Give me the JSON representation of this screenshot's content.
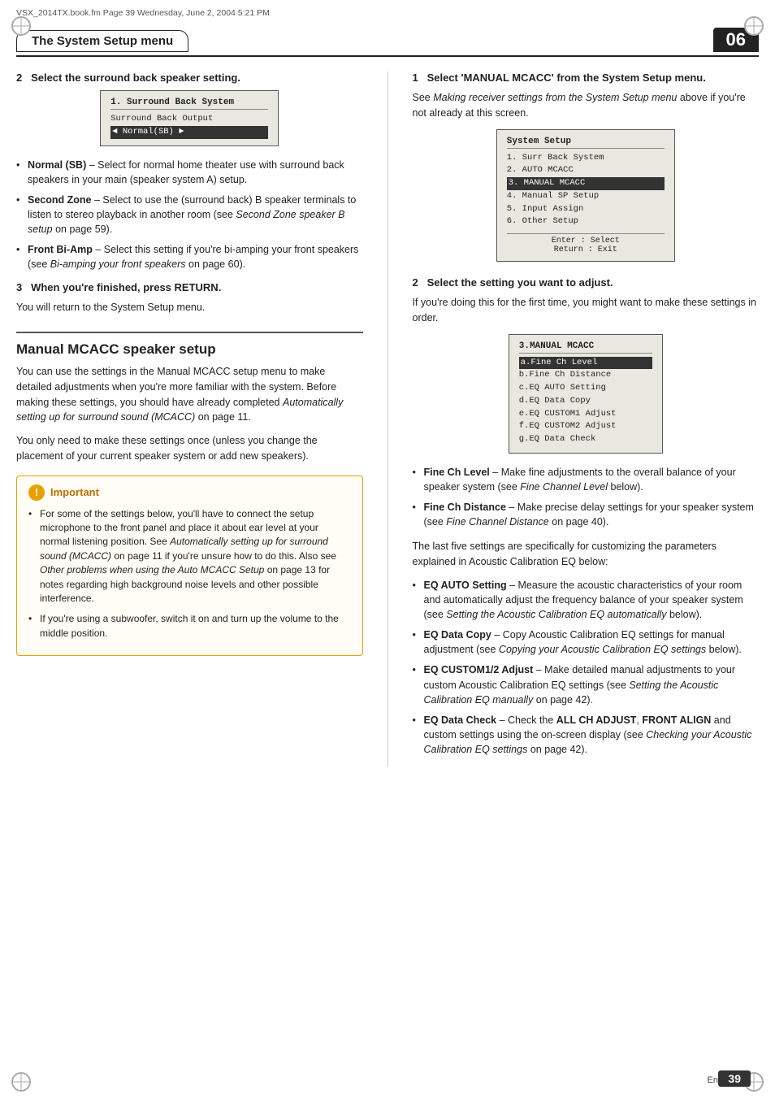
{
  "file_info": "VSX_2014TX.book.fm  Page 39  Wednesday, June 2, 2004  5:21 PM",
  "header": {
    "title": "The System Setup menu",
    "chapter": "06"
  },
  "left": {
    "step2_heading": "2   Select the surround back speaker setting.",
    "lcd1": {
      "title": "1. Surround Back System",
      "subtitle": "Surround Back Output",
      "selected_row": "◄ Normal(SB) ►"
    },
    "bullets": [
      {
        "term": "Normal (SB)",
        "desc": "– Select for normal home theater use with surround back speakers in your main (speaker system A) setup."
      },
      {
        "term": "Second Zone",
        "desc": "– Select to use the (surround back) B speaker terminals to listen to stereo playback in another room (see Second Zone speaker B setup on page 59)."
      },
      {
        "term": "Front Bi-Amp",
        "desc": "– Select this setting if you're bi-amping your front speakers (see Bi-amping your front speakers on page 60)."
      }
    ],
    "step3_heading": "3   When you're finished, press RETURN.",
    "step3_body": "You will return to the System Setup menu.",
    "section_title": "Manual MCACC speaker setup",
    "section_body1": "You can use the settings in the Manual MCACC setup menu to make detailed adjustments when you're more familiar with the system. Before making these settings, you should have already completed Automatically setting up for surround sound (MCACC) on page 11.",
    "section_body2": "You only need to make these settings once (unless you change the placement of your current speaker system or add new speakers).",
    "important_header": "Important",
    "important_bullets": [
      "For some of the settings below, you'll have to connect the setup microphone to the front panel and place it about ear level at your normal listening position. See Automatically setting up for surround sound (MCACC) on page 11 if you're unsure how to do this. Also see Other problems when using the Auto MCACC Setup on page 13 for notes regarding high background noise levels and other possible interference.",
      "If you're using a subwoofer, switch it on and turn up the volume to the middle position."
    ]
  },
  "right": {
    "step1_heading": "1   Select 'MANUAL MCACC' from the System Setup menu.",
    "step1_body": "See Making receiver settings from the System Setup menu above if you're not already at this screen.",
    "lcd2": {
      "title": "System Setup",
      "rows": [
        "1. Surr Back System",
        "2. AUTO  MCACC",
        "3. MANUAL MCACC",
        "4. Manual SP Setup",
        "5. Input Assign",
        "6. Other Setup"
      ],
      "selected_row_index": 2,
      "nav": "Enter : Select\nReturn : Exit"
    },
    "step2_heading": "2   Select the setting you want to adjust.",
    "step2_body": "If you're doing this for the first time, you might want to make these settings in order.",
    "lcd3": {
      "title": "3.MANUAL MCACC",
      "rows": [
        "a.Fine Ch Level",
        "b.Fine Ch Distance",
        "c.EQ AUTO Setting",
        "d.EQ Data Copy",
        "e.EQ CUSTOM1 Adjust",
        "f.EQ CUSTOM2 Adjust",
        "g.EQ Data Check"
      ],
      "selected_row_index": 0
    },
    "bullets": [
      {
        "term": "Fine Ch Level",
        "desc": "– Make fine adjustments to the overall balance of your speaker system (see Fine Channel Level below)."
      },
      {
        "term": "Fine Ch Distance",
        "desc": "– Make precise delay settings for your speaker system (see Fine Channel Distance on page 40)."
      }
    ],
    "last_five_intro": "The last five settings are specifically for customizing the parameters explained in Acoustic Calibration EQ below:",
    "last_five_bullets": [
      {
        "term": "EQ AUTO Setting",
        "desc": "– Measure the acoustic characteristics of your room and automatically adjust the frequency balance of your speaker system (see Setting the Acoustic Calibration EQ automatically below)."
      },
      {
        "term": "EQ Data Copy",
        "desc": "– Copy Acoustic Calibration EQ settings for manual adjustment (see Copying your Acoustic Calibration EQ settings below)."
      },
      {
        "term": "EQ CUSTOM1/2 Adjust",
        "desc": "– Make detailed manual adjustments to your custom Acoustic Calibration EQ settings (see Setting the Acoustic Calibration EQ manually on page 42)."
      },
      {
        "term": "EQ Data Check",
        "desc": "– Check the ALL CH ADJUST, FRONT ALIGN and custom settings using the on-screen display (see Checking your Acoustic Calibration EQ settings on page 42)."
      }
    ]
  },
  "page": {
    "number": "39",
    "lang": "En"
  }
}
